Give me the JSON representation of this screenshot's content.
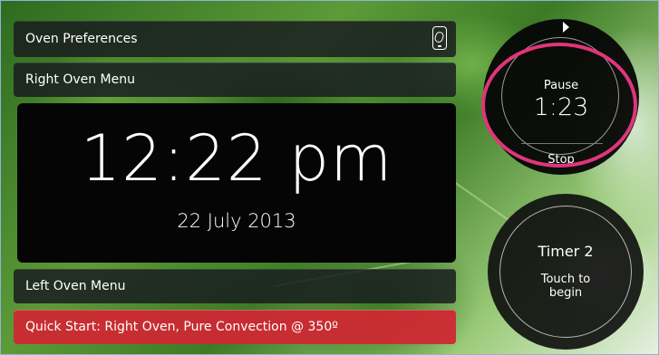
{
  "menu": {
    "oven_preferences": "Oven Preferences",
    "right_oven_menu": "Right Oven Menu",
    "left_oven_menu": "Left Oven Menu",
    "quick_start": "Quick Start: Right Oven, Pure Convection @ 350º"
  },
  "clock": {
    "time": "12:22 pm",
    "date": "22 July 2013"
  },
  "timer1": {
    "pause_label": "Pause",
    "countdown": "1:23",
    "stop_label": "Stop"
  },
  "timer2": {
    "label": "Timer 2",
    "line1": "Touch to",
    "line2": "begin"
  },
  "colors": {
    "quick_start_bg": "#cd2832",
    "highlight_ring": "#e0357a"
  },
  "icons": {
    "preferences": "phone-link-icon"
  }
}
